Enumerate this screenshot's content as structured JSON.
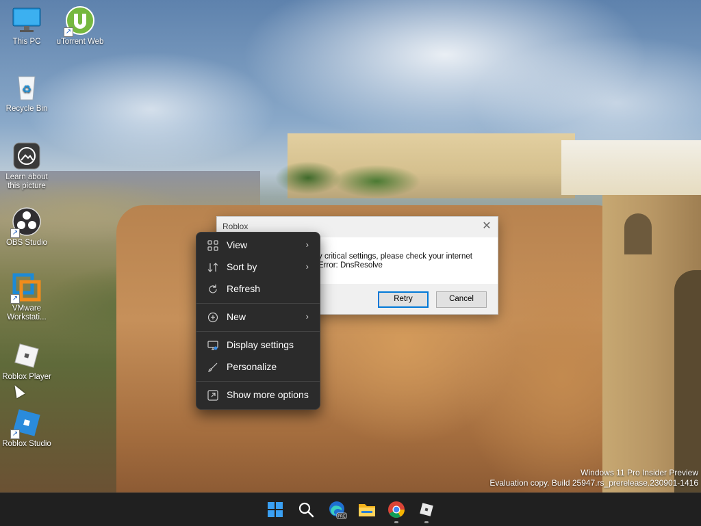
{
  "desktop": {
    "icons": [
      {
        "label": "This PC",
        "icon": "monitor-icon"
      },
      {
        "label": "uTorrent Web",
        "icon": "utorrent-icon"
      },
      {
        "label": "Recycle Bin",
        "icon": "recycle-bin-icon"
      },
      {
        "label": "Learn about this picture",
        "icon": "camera-lens-icon"
      },
      {
        "label": "OBS Studio",
        "icon": "obs-icon"
      },
      {
        "label": "VMware Workstati...",
        "icon": "vmware-icon"
      },
      {
        "label": "Roblox Player",
        "icon": "roblox-player-icon"
      },
      {
        "label": "Roblox Studio",
        "icon": "roblox-studio-icon"
      }
    ]
  },
  "dialog": {
    "title": "Roblox",
    "message_line1": "y critical settings, please check your internet",
    "message_line2": "Error: DnsResolve",
    "retry_label": "Retry",
    "cancel_label": "Cancel",
    "close_glyph": "✕"
  },
  "context_menu": {
    "items": [
      {
        "label": "View",
        "icon": "grid-view-icon",
        "submenu": true
      },
      {
        "label": "Sort by",
        "icon": "sort-icon",
        "submenu": true
      },
      {
        "label": "Refresh",
        "icon": "refresh-icon",
        "submenu": false
      },
      {
        "label": "New",
        "icon": "plus-circle-icon",
        "submenu": true
      },
      {
        "label": "Display settings",
        "icon": "display-icon",
        "submenu": false
      },
      {
        "label": "Personalize",
        "icon": "brush-icon",
        "submenu": false
      },
      {
        "label": "Show more options",
        "icon": "expand-icon",
        "submenu": false
      }
    ],
    "arrow_glyph": "›"
  },
  "watermark": {
    "line1": "Windows 11 Pro Insider Preview",
    "line2": "Evaluation copy. Build 25947.rs_prerelease.230901-1416"
  },
  "taskbar": {
    "apps": [
      "windows-start-icon",
      "search-icon",
      "edge-beta-icon",
      "file-explorer-icon",
      "chrome-icon",
      "roblox-icon"
    ]
  },
  "colors": {
    "menu_bg": "#2b2b2b",
    "taskbar_bg": "#202020",
    "accent": "#0078d7"
  }
}
